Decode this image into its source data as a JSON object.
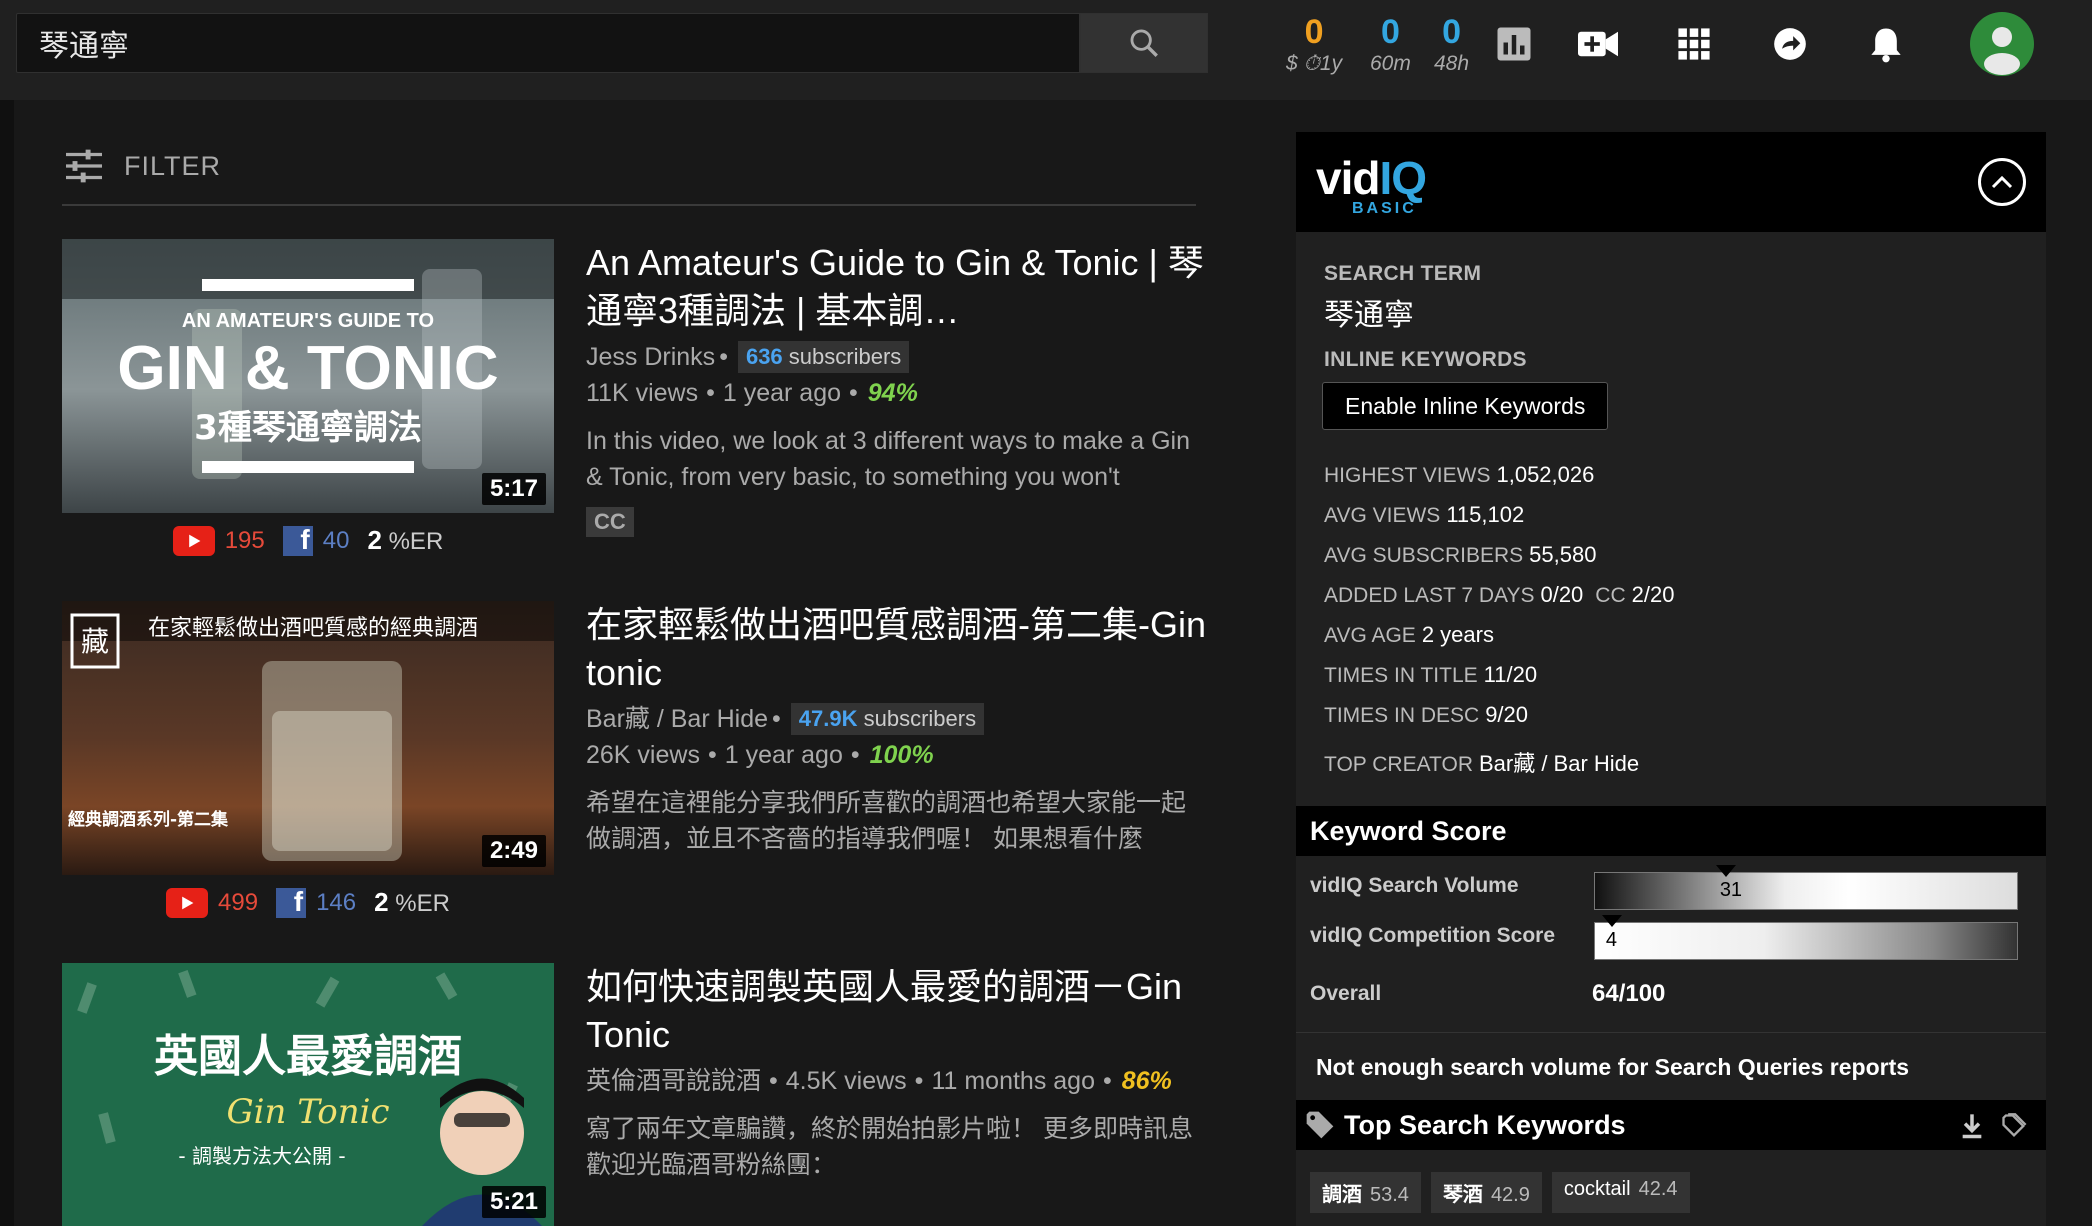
{
  "search": {
    "query": "琴通寧"
  },
  "header_stats": [
    {
      "value": "0",
      "label": "$ ⏱1y",
      "color": "#f0a020"
    },
    {
      "value": "0",
      "label": "60m",
      "color": "#33a6e0"
    },
    {
      "value": "0",
      "label": "48h",
      "color": "#33a6e0"
    }
  ],
  "filter": {
    "label": "FILTER"
  },
  "videos": [
    {
      "title": "An Amateur's Guide to Gin & Tonic | 琴通寧3種調法 | 基本調…",
      "thumb_lines": [
        "AN AMATEUR'S GUIDE TO",
        "GIN & TONIC",
        "3種琴通寧調法"
      ],
      "duration": "5:17",
      "channel": "Jess Drinks",
      "subs": "636",
      "subs_word": "subscribers",
      "views": "11K views",
      "age": "1 year ago",
      "score": "94%",
      "desc": "In this video, we look at 3 different ways to make a Gin & Tonic, from very basic, to something you won't",
      "badge": "CC",
      "yt": "195",
      "fb": "40",
      "er": "2",
      "er_unit": "%ER"
    },
    {
      "title": "在家輕鬆做出酒吧質感調酒-第二集-Gin tonic",
      "thumb_lines": [
        "在家輕鬆做出酒吧質感的經典調酒",
        "經典調酒系列-第二集"
      ],
      "duration": "2:49",
      "channel": "Bar藏 / Bar Hide",
      "subs": "47.9K",
      "subs_word": "subscribers",
      "views": "26K views",
      "age": "1 year ago",
      "score": "100%",
      "desc": "希望在這裡能分享我們所喜歡的調酒也希望大家能一起做調酒，並且不吝嗇的指導我們喔！ 如果想看什麼",
      "yt": "499",
      "fb": "146",
      "er": "2",
      "er_unit": "%ER"
    },
    {
      "title": "如何快速調製英國人最愛的調酒－Gin Tonic",
      "thumb_lines": [
        "英國人最愛調酒",
        "Gin Tonic",
        "- 調製方法大公開 -"
      ],
      "duration": "5:21",
      "channel": "英倫酒哥說說酒",
      "views": "4.5K views",
      "age": "11 months ago",
      "score": "86%",
      "desc": "寫了兩年文章騙讚，終於開始拍影片啦！ 更多即時訊息歡迎光臨酒哥粉絲團："
    }
  ],
  "vidiq": {
    "logo_vid": "vid",
    "logo_iq": "IQ",
    "plan": "BASIC",
    "search_term_label": "SEARCH TERM",
    "search_term": "琴通寧",
    "inline_label": "INLINE KEYWORDS",
    "inline_button": "Enable Inline Keywords",
    "rows": [
      {
        "label": "HIGHEST VIEWS",
        "value": "1,052,026"
      },
      {
        "label": "AVG VIEWS",
        "value": "115,102"
      },
      {
        "label": "AVG SUBSCRIBERS",
        "value": "55,580"
      },
      {
        "label": "ADDED LAST 7 DAYS",
        "value": "0/20",
        "label2": "CC",
        "value2": "2/20"
      },
      {
        "label": "AVG AGE",
        "value": "2 years"
      },
      {
        "label": "TIMES IN TITLE",
        "value": "11/20"
      },
      {
        "label": "TIMES IN DESC",
        "value": "9/20"
      },
      {
        "label": "TOP CREATOR",
        "value": "Bar藏 / Bar Hide"
      }
    ],
    "keyword_score_title": "Keyword Score",
    "search_volume_label": "vidIQ Search Volume",
    "search_volume": 31,
    "competition_label": "vidIQ Competition Score",
    "competition": 4,
    "overall_label": "Overall",
    "overall": "64/100",
    "notice": "Not enough search volume for Search Queries reports",
    "top_keywords_title": "Top Search Keywords",
    "keywords": [
      {
        "term": "調酒",
        "score": "53.4"
      },
      {
        "term": "琴酒",
        "score": "42.9"
      },
      {
        "term": "cocktail",
        "score": "42.4"
      }
    ]
  }
}
